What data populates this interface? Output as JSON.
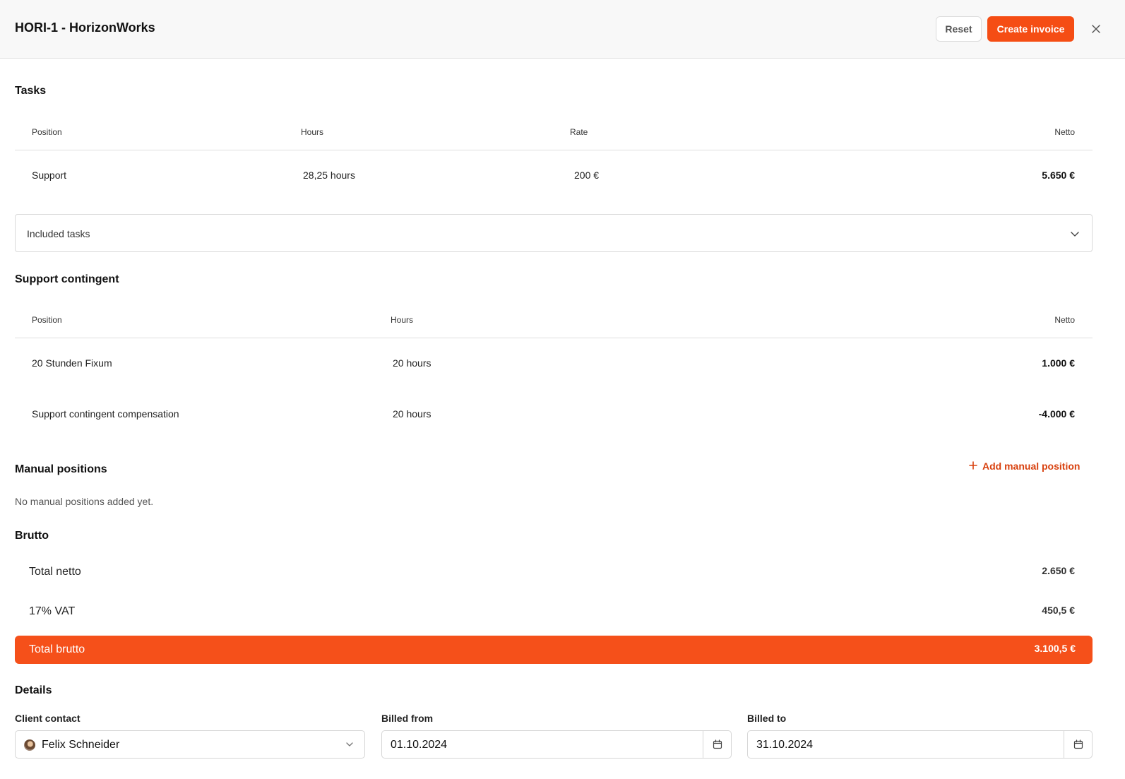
{
  "header": {
    "title": "HORI-1 - HorizonWorks",
    "reset_label": "Reset",
    "create_label": "Create invoice",
    "close_icon": "close-icon"
  },
  "tasks": {
    "title": "Tasks",
    "columns": [
      "Position",
      "Hours",
      "Rate",
      "Netto"
    ],
    "rows": [
      {
        "position": "Support",
        "hours": "28,25 hours",
        "rate": "200 €",
        "netto": "5.650 €"
      }
    ],
    "included_label": "Included tasks"
  },
  "support": {
    "title": "Support contingent",
    "columns": [
      "Position",
      "Hours",
      "Netto"
    ],
    "rows": [
      {
        "position": "20 Stunden Fixum",
        "hours": "20 hours",
        "netto": "1.000 €"
      },
      {
        "position": "Support contingent compensation",
        "hours": "20 hours",
        "netto": "-4.000 €"
      }
    ]
  },
  "manual": {
    "title": "Manual positions",
    "add_label": "Add manual position",
    "empty_text": "No manual positions added yet."
  },
  "brutto": {
    "title": "Brutto",
    "total_netto_label": "Total netto",
    "total_netto_value": "2.650 €",
    "vat_label": "17% VAT",
    "vat_value": "450,5 €",
    "total_brutto_label": "Total brutto",
    "total_brutto_value": "3.100,5 €"
  },
  "details": {
    "title": "Details",
    "client_label": "Client contact",
    "client_value": "Felix Schneider",
    "billed_from_label": "Billed from",
    "billed_from_value": "01.10.2024",
    "billed_to_label": "Billed to",
    "billed_to_value": "31.10.2024"
  },
  "colors": {
    "accent": "#f54d14",
    "accent_text": "#d8410f",
    "header_bg": "#f8f8f8"
  }
}
